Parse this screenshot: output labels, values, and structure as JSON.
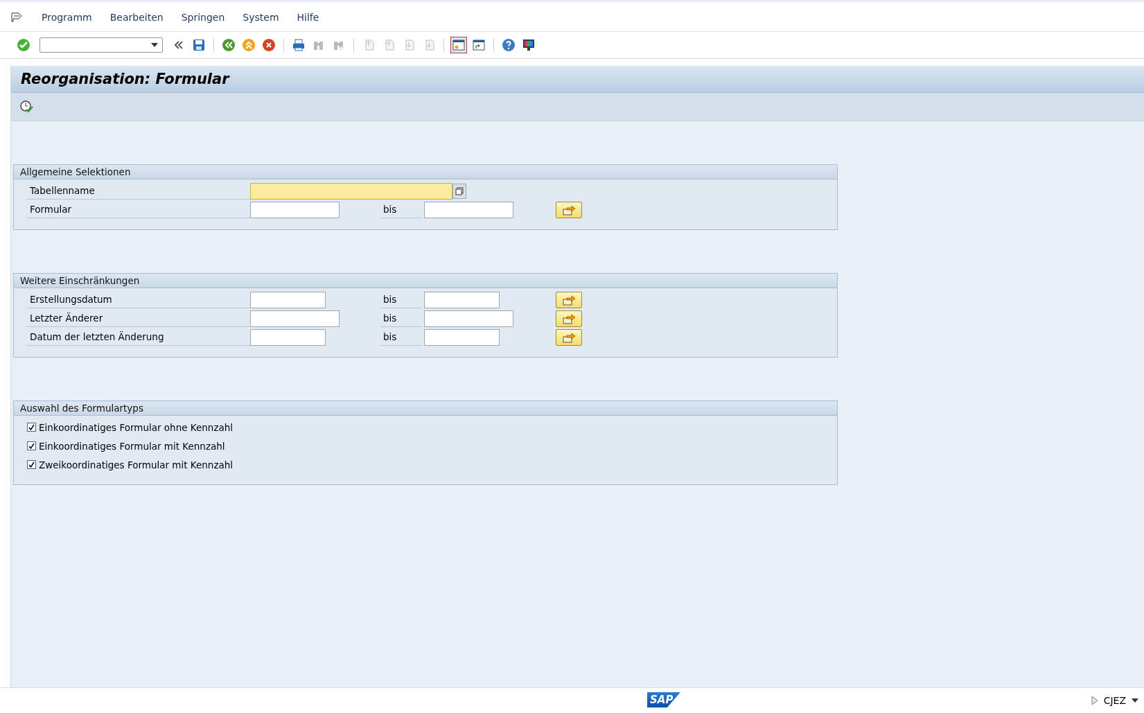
{
  "menu": [
    {
      "label": "Programm"
    },
    {
      "label": "Bearbeiten"
    },
    {
      "label": "Springen"
    },
    {
      "label": "System"
    },
    {
      "label": "Hilfe"
    }
  ],
  "toolbar": [
    {
      "kind": "enter",
      "disabled": false
    },
    {
      "kind": "command"
    },
    {
      "kind": "collapse"
    },
    {
      "kind": "save",
      "disabled": false
    },
    {
      "kind": "separator"
    },
    {
      "kind": "back",
      "disabled": false
    },
    {
      "kind": "exit",
      "disabled": false
    },
    {
      "kind": "cancel",
      "disabled": false
    },
    {
      "kind": "separator"
    },
    {
      "kind": "print",
      "disabled": false
    },
    {
      "kind": "find",
      "disabled": true
    },
    {
      "kind": "findnext",
      "disabled": true
    },
    {
      "kind": "separator"
    },
    {
      "kind": "firstpage",
      "disabled": true
    },
    {
      "kind": "prevpage",
      "disabled": true
    },
    {
      "kind": "nextpage",
      "disabled": true
    },
    {
      "kind": "lastpage",
      "disabled": true
    },
    {
      "kind": "separator"
    },
    {
      "kind": "session",
      "disabled": false
    },
    {
      "kind": "shortcut",
      "disabled": false
    },
    {
      "kind": "separator"
    },
    {
      "kind": "help",
      "disabled": false
    },
    {
      "kind": "layout",
      "disabled": false
    }
  ],
  "title": "Reorganisation: Formular",
  "groups": [
    {
      "title": "Allgemeine Selektionen",
      "rows": [
        {
          "kind": "single",
          "label": "Tabellenname",
          "focused": true
        },
        {
          "kind": "range",
          "label": "Formular",
          "to_label": "bis",
          "focused": false
        }
      ]
    },
    {
      "title": "Weitere Einschränkungen",
      "rows": [
        {
          "kind": "daterange",
          "label": "Erstellungsdatum",
          "to_label": "bis",
          "focused": false
        },
        {
          "kind": "range",
          "label": "Letzter Änderer",
          "to_label": "bis",
          "focused": false
        },
        {
          "kind": "daterange",
          "label": "Datum der letzten Änderung",
          "to_label": "bis",
          "focused": false
        }
      ]
    },
    {
      "title": "Auswahl des Formulartyps",
      "rows": [
        {
          "kind": "checkbox",
          "label": "Einkoordinatiges Formular ohne Kennzahl",
          "checked": true
        },
        {
          "kind": "checkbox",
          "label": "Einkoordinatiges Formular mit Kennzahl",
          "checked": true
        },
        {
          "kind": "checkbox",
          "label": "Zweikoordinatiges Formular mit Kennzahl",
          "checked": true
        }
      ]
    }
  ],
  "status_bar": {
    "logo": "SAP",
    "system": "CJEZ"
  }
}
